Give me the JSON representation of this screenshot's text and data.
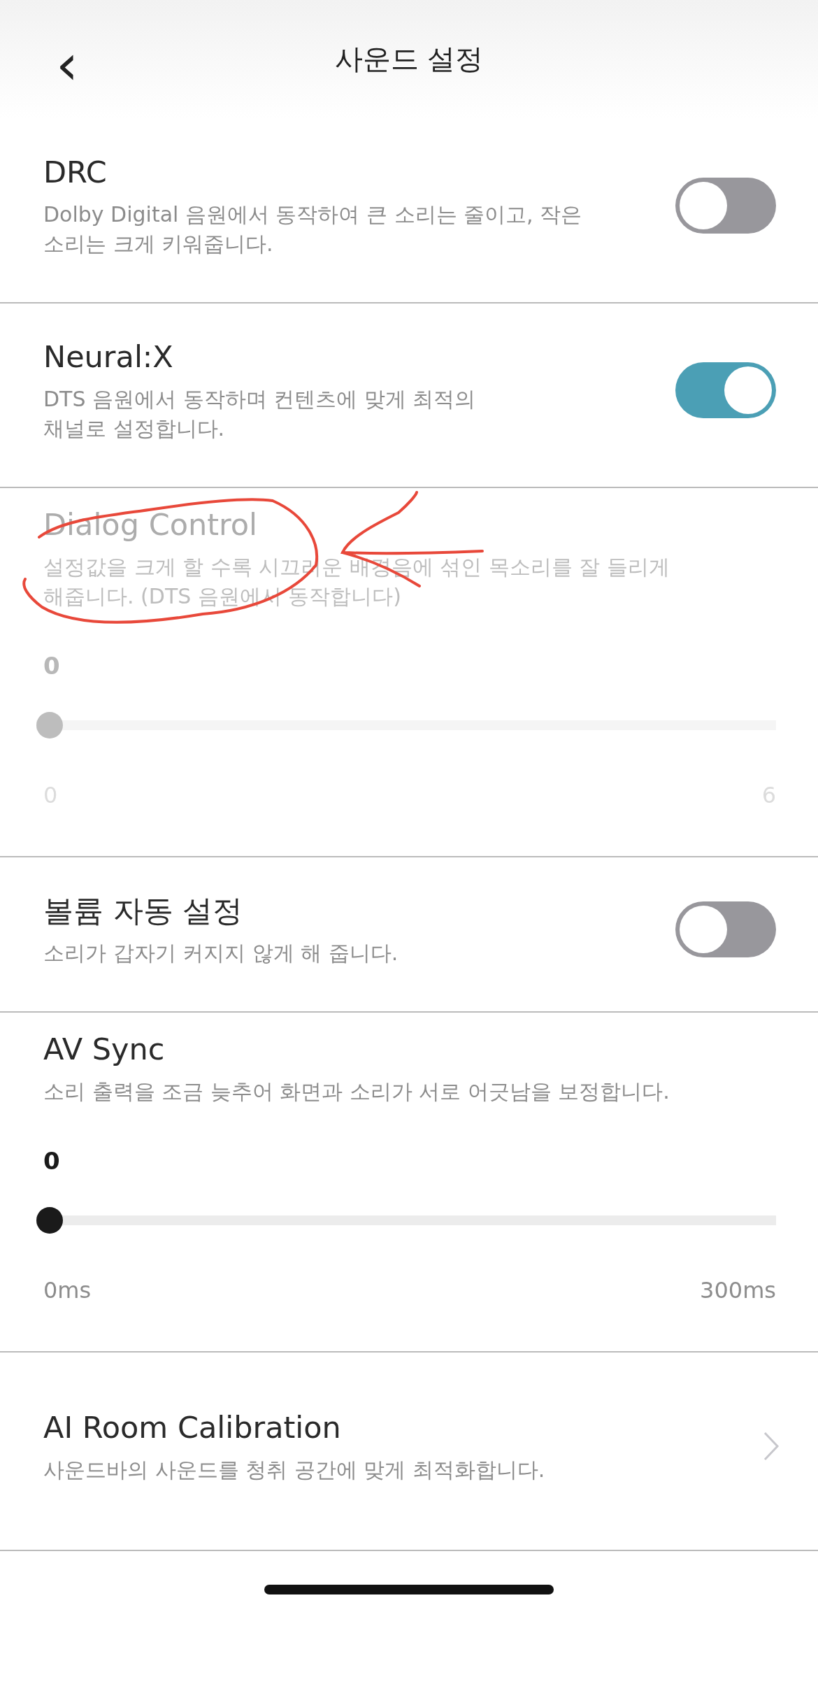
{
  "header": {
    "back": "‹",
    "title": "사운드 설정"
  },
  "settings": [
    {
      "kind": "toggle",
      "title": "DRC",
      "description_lines": [
        "Dolby Digital 음원에서 동작하여 큰 소리는 줄이고, 작은",
        "소리는 크게 키워줍니다."
      ],
      "on": false,
      "disabled": false
    },
    {
      "kind": "toggle",
      "title": "Neural:X",
      "description_lines": [
        "DTS 음원에서 동작하며 컨텐츠에 맞게 최적의",
        "채널로 설정합니다."
      ],
      "on": true,
      "disabled": false
    },
    {
      "kind": "slider",
      "title": "Dialog Control",
      "description_lines": [
        "설정값을 크게 할 수록 시끄러운 배경음에 섞인 목소리를 잘 들리게",
        "해줍니다. (DTS 음원에서 동작합니다)"
      ],
      "value": "0",
      "level": 0,
      "min_label": "0",
      "max_label": "6",
      "disabled": true
    },
    {
      "kind": "toggle",
      "title": "볼륨 자동 설정",
      "description_lines": [
        "소리가 갑자기 커지지 않게 해 줍니다."
      ],
      "on": false,
      "disabled": false
    },
    {
      "kind": "slider",
      "title": "AV Sync",
      "description_lines": [
        "소리 출력을 조금 늦추어 화면과 소리가 서로 어긋남을 보정합니다."
      ],
      "value": "0",
      "level": 0,
      "min_label": "0ms",
      "max_label": "300ms",
      "disabled": false
    },
    {
      "kind": "link",
      "title": "AI Room Calibration",
      "description_lines": [
        "사운드바의 사운드를 청취 공간에 맞게 최적화합니다."
      ],
      "disabled": false
    }
  ]
}
